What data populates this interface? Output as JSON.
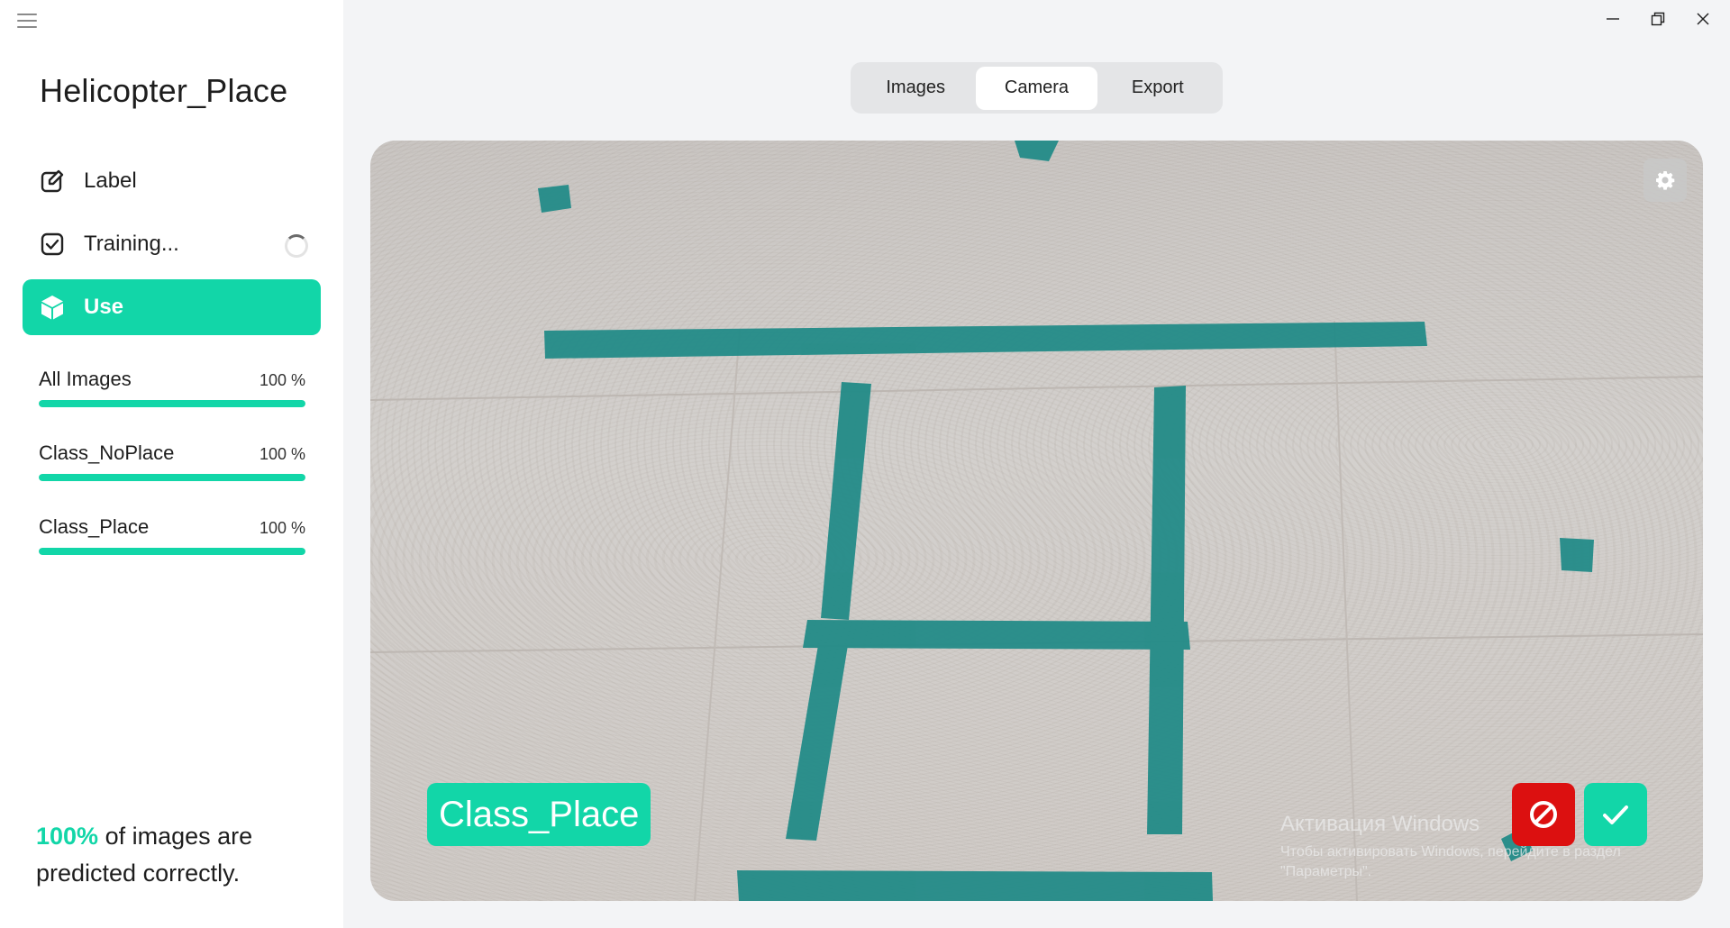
{
  "sidebar": {
    "project_title": "Helicopter_Place",
    "nav": [
      {
        "label": "Label",
        "icon": "edit-icon"
      },
      {
        "label": "Training...",
        "icon": "checkbox-icon"
      },
      {
        "label": "Use",
        "icon": "cube-icon"
      }
    ],
    "stats": [
      {
        "name": "All Images",
        "percent_text": "100 %",
        "progress": 1.0
      },
      {
        "name": "Class_NoPlace",
        "percent_text": "100 %",
        "progress": 1.0
      },
      {
        "name": "Class_Place",
        "percent_text": "100 %",
        "progress": 1.0
      }
    ],
    "summary": {
      "highlight": "100%",
      "rest": "of images are predicted correctly."
    }
  },
  "window_controls": [
    "minimize-icon",
    "restore-icon",
    "close-icon"
  ],
  "tabs": [
    {
      "label": "Images",
      "active": false
    },
    {
      "label": "Camera",
      "active": true
    },
    {
      "label": "Export",
      "active": false
    }
  ],
  "camera": {
    "predicted_class": "Class_Place",
    "settings_icon": "gear-icon",
    "reject_icon": "prohibit-icon",
    "accept_icon": "checkmark-icon",
    "watermark": {
      "title": "Активация Windows",
      "subtitle": "Чтобы активировать Windows, перейдите в раздел \"Параметры\"."
    }
  },
  "colors": {
    "accent": "#12d6a8",
    "reject": "#dc1010",
    "tape": "#1f8a86"
  }
}
